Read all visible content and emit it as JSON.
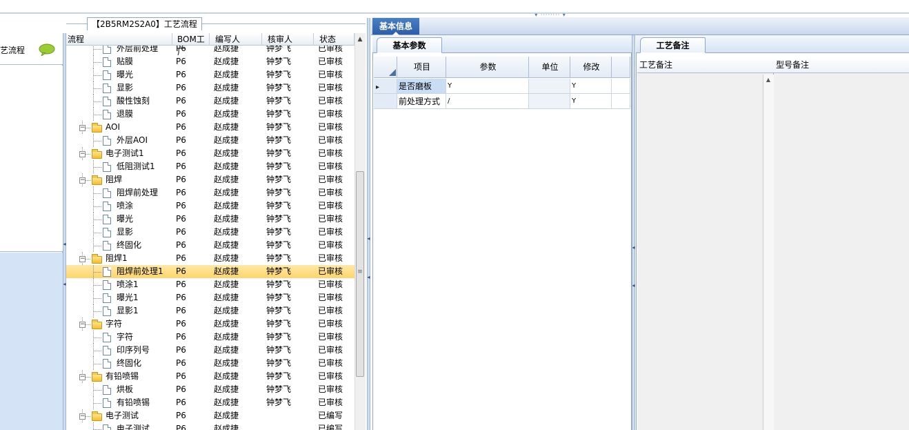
{
  "process_group": {
    "title": "【2B5RM2S2A0】工艺流程"
  },
  "left_panel": {
    "title": "艺流程"
  },
  "tree": {
    "columns": [
      "流程",
      "BOM工厂",
      "编写人",
      "核审人",
      "状态"
    ],
    "rows": [
      {
        "name": "外层前处理",
        "kind": "doc",
        "level": 1,
        "factory": "P6",
        "author": "赵成捷",
        "reviewer": "钟梦飞",
        "status": "已审核"
      },
      {
        "name": "贴膜",
        "kind": "doc",
        "level": 1,
        "factory": "P6",
        "author": "赵成捷",
        "reviewer": "钟梦飞",
        "status": "已审核"
      },
      {
        "name": "曝光",
        "kind": "doc",
        "level": 1,
        "factory": "P6",
        "author": "赵成捷",
        "reviewer": "钟梦飞",
        "status": "已审核"
      },
      {
        "name": "显影",
        "kind": "doc",
        "level": 1,
        "factory": "P6",
        "author": "赵成捷",
        "reviewer": "钟梦飞",
        "status": "已审核"
      },
      {
        "name": "酸性蚀刻",
        "kind": "doc",
        "level": 1,
        "factory": "P6",
        "author": "赵成捷",
        "reviewer": "钟梦飞",
        "status": "已审核"
      },
      {
        "name": "退膜",
        "kind": "doc",
        "level": 1,
        "factory": "P6",
        "author": "赵成捷",
        "reviewer": "钟梦飞",
        "status": "已审核"
      },
      {
        "name": "AOI",
        "kind": "folder",
        "level": 0,
        "factory": "P6",
        "author": "赵成捷",
        "reviewer": "钟梦飞",
        "status": "已审核"
      },
      {
        "name": "外层AOI",
        "kind": "doc",
        "level": 1,
        "factory": "P6",
        "author": "赵成捷",
        "reviewer": "钟梦飞",
        "status": "已审核"
      },
      {
        "name": "电子测试1",
        "kind": "folder",
        "level": 0,
        "factory": "P6",
        "author": "赵成捷",
        "reviewer": "钟梦飞",
        "status": "已审核"
      },
      {
        "name": "低阻测试1",
        "kind": "doc",
        "level": 1,
        "factory": "P6",
        "author": "赵成捷",
        "reviewer": "钟梦飞",
        "status": "已审核"
      },
      {
        "name": "阻焊",
        "kind": "folder",
        "level": 0,
        "factory": "P6",
        "author": "赵成捷",
        "reviewer": "钟梦飞",
        "status": "已审核"
      },
      {
        "name": "阻焊前处理",
        "kind": "doc",
        "level": 1,
        "factory": "P6",
        "author": "赵成捷",
        "reviewer": "钟梦飞",
        "status": "已审核"
      },
      {
        "name": "喷涂",
        "kind": "doc",
        "level": 1,
        "factory": "P6",
        "author": "赵成捷",
        "reviewer": "钟梦飞",
        "status": "已审核"
      },
      {
        "name": "曝光",
        "kind": "doc",
        "level": 1,
        "factory": "P6",
        "author": "赵成捷",
        "reviewer": "钟梦飞",
        "status": "已审核"
      },
      {
        "name": "显影",
        "kind": "doc",
        "level": 1,
        "factory": "P6",
        "author": "赵成捷",
        "reviewer": "钟梦飞",
        "status": "已审核"
      },
      {
        "name": "终固化",
        "kind": "doc",
        "level": 1,
        "factory": "P6",
        "author": "赵成捷",
        "reviewer": "钟梦飞",
        "status": "已审核"
      },
      {
        "name": "阻焊1",
        "kind": "folder",
        "level": 0,
        "factory": "P6",
        "author": "赵成捷",
        "reviewer": "钟梦飞",
        "status": "已审核"
      },
      {
        "name": "阻焊前处理1",
        "kind": "doc",
        "level": 1,
        "factory": "P6",
        "author": "赵成捷",
        "reviewer": "钟梦飞",
        "status": "已审核",
        "selected": true
      },
      {
        "name": "喷涂1",
        "kind": "doc",
        "level": 1,
        "factory": "P6",
        "author": "赵成捷",
        "reviewer": "钟梦飞",
        "status": "已审核"
      },
      {
        "name": "曝光1",
        "kind": "doc",
        "level": 1,
        "factory": "P6",
        "author": "赵成捷",
        "reviewer": "钟梦飞",
        "status": "已审核"
      },
      {
        "name": "显影1",
        "kind": "doc",
        "level": 1,
        "factory": "P6",
        "author": "赵成捷",
        "reviewer": "钟梦飞",
        "status": "已审核"
      },
      {
        "name": "字符",
        "kind": "folder",
        "level": 0,
        "factory": "P6",
        "author": "赵成捷",
        "reviewer": "钟梦飞",
        "status": "已审核"
      },
      {
        "name": "字符",
        "kind": "doc",
        "level": 1,
        "factory": "P6",
        "author": "赵成捷",
        "reviewer": "钟梦飞",
        "status": "已审核"
      },
      {
        "name": "印序列号",
        "kind": "doc",
        "level": 1,
        "factory": "P6",
        "author": "赵成捷",
        "reviewer": "钟梦飞",
        "status": "已审核"
      },
      {
        "name": "终固化",
        "kind": "doc",
        "level": 1,
        "factory": "P6",
        "author": "赵成捷",
        "reviewer": "钟梦飞",
        "status": "已审核"
      },
      {
        "name": "有铅喷锡",
        "kind": "folder",
        "level": 0,
        "factory": "P6",
        "author": "赵成捷",
        "reviewer": "钟梦飞",
        "status": "已审核"
      },
      {
        "name": "烘板",
        "kind": "doc",
        "level": 1,
        "factory": "P6",
        "author": "赵成捷",
        "reviewer": "钟梦飞",
        "status": "已审核"
      },
      {
        "name": "有铅喷锡",
        "kind": "doc",
        "level": 1,
        "factory": "P6",
        "author": "赵成捷",
        "reviewer": "钟梦飞",
        "status": "已审核"
      },
      {
        "name": "电子测试",
        "kind": "folder",
        "level": 0,
        "factory": "P6",
        "author": "赵成捷",
        "reviewer": "",
        "status": "已编写"
      },
      {
        "name": "电子测试",
        "kind": "doc",
        "level": 1,
        "factory": "P6",
        "author": "赵成捷",
        "reviewer": "",
        "status": "已编写"
      }
    ]
  },
  "right": {
    "main_tab": "基本信息",
    "params_tab": "基本参数",
    "notes_tab": "工艺备注",
    "params_grid": {
      "columns": [
        "项目",
        "参数",
        "单位",
        "修改"
      ],
      "rows": [
        {
          "item": "是否磨板",
          "param": "Y",
          "unit": "",
          "modify": "Y",
          "current": true
        },
        {
          "item": "前处理方式",
          "param": "/",
          "unit": "",
          "modify": "Y",
          "current": false
        }
      ]
    },
    "notes_columns": [
      "工艺备注",
      "型号备注"
    ]
  }
}
